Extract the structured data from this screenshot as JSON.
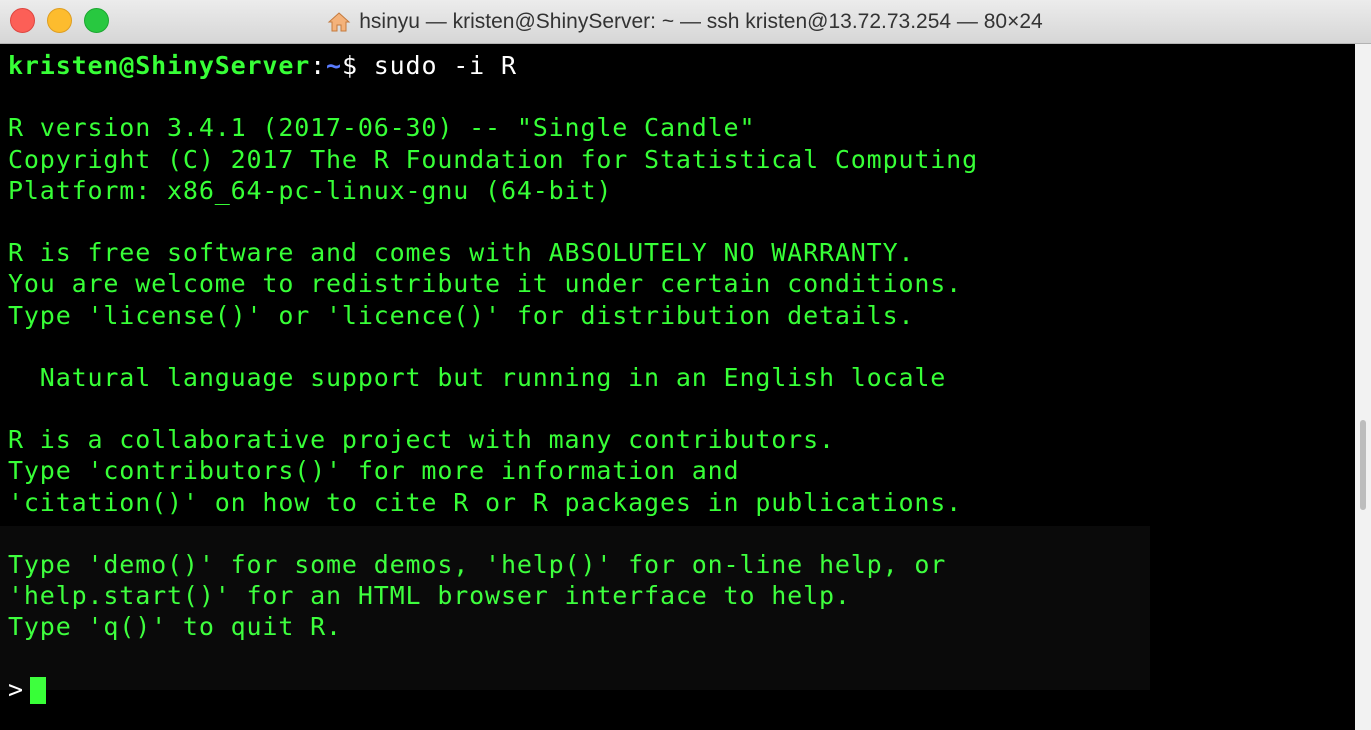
{
  "window": {
    "title": "hsinyu — kristen@ShinyServer: ~ — ssh kristen@13.72.73.254 — 80×24",
    "title_icon": "home-icon"
  },
  "terminal": {
    "prompt": {
      "user_host": "kristen@ShinyServer",
      "separator": ":",
      "path": "~",
      "symbol": "$",
      "command": " sudo -i R"
    },
    "output": [
      "",
      "R version 3.4.1 (2017-06-30) -- \"Single Candle\"",
      "Copyright (C) 2017 The R Foundation for Statistical Computing",
      "Platform: x86_64-pc-linux-gnu (64-bit)",
      "",
      "R is free software and comes with ABSOLUTELY NO WARRANTY.",
      "You are welcome to redistribute it under certain conditions.",
      "Type 'license()' or 'licence()' for distribution details.",
      "",
      "  Natural language support but running in an English locale",
      "",
      "R is a collaborative project with many contributors.",
      "Type 'contributors()' for more information and",
      "'citation()' on how to cite R or R packages in publications.",
      "",
      "Type 'demo()' for some demos, 'help()' for on-line help, or",
      "'help.start()' for an HTML browser interface to help.",
      "Type 'q()' to quit R.",
      ""
    ],
    "r_prompt": ">",
    "colors": {
      "text": "#37ff37",
      "background": "#000000",
      "path": "#5a7cff"
    }
  }
}
